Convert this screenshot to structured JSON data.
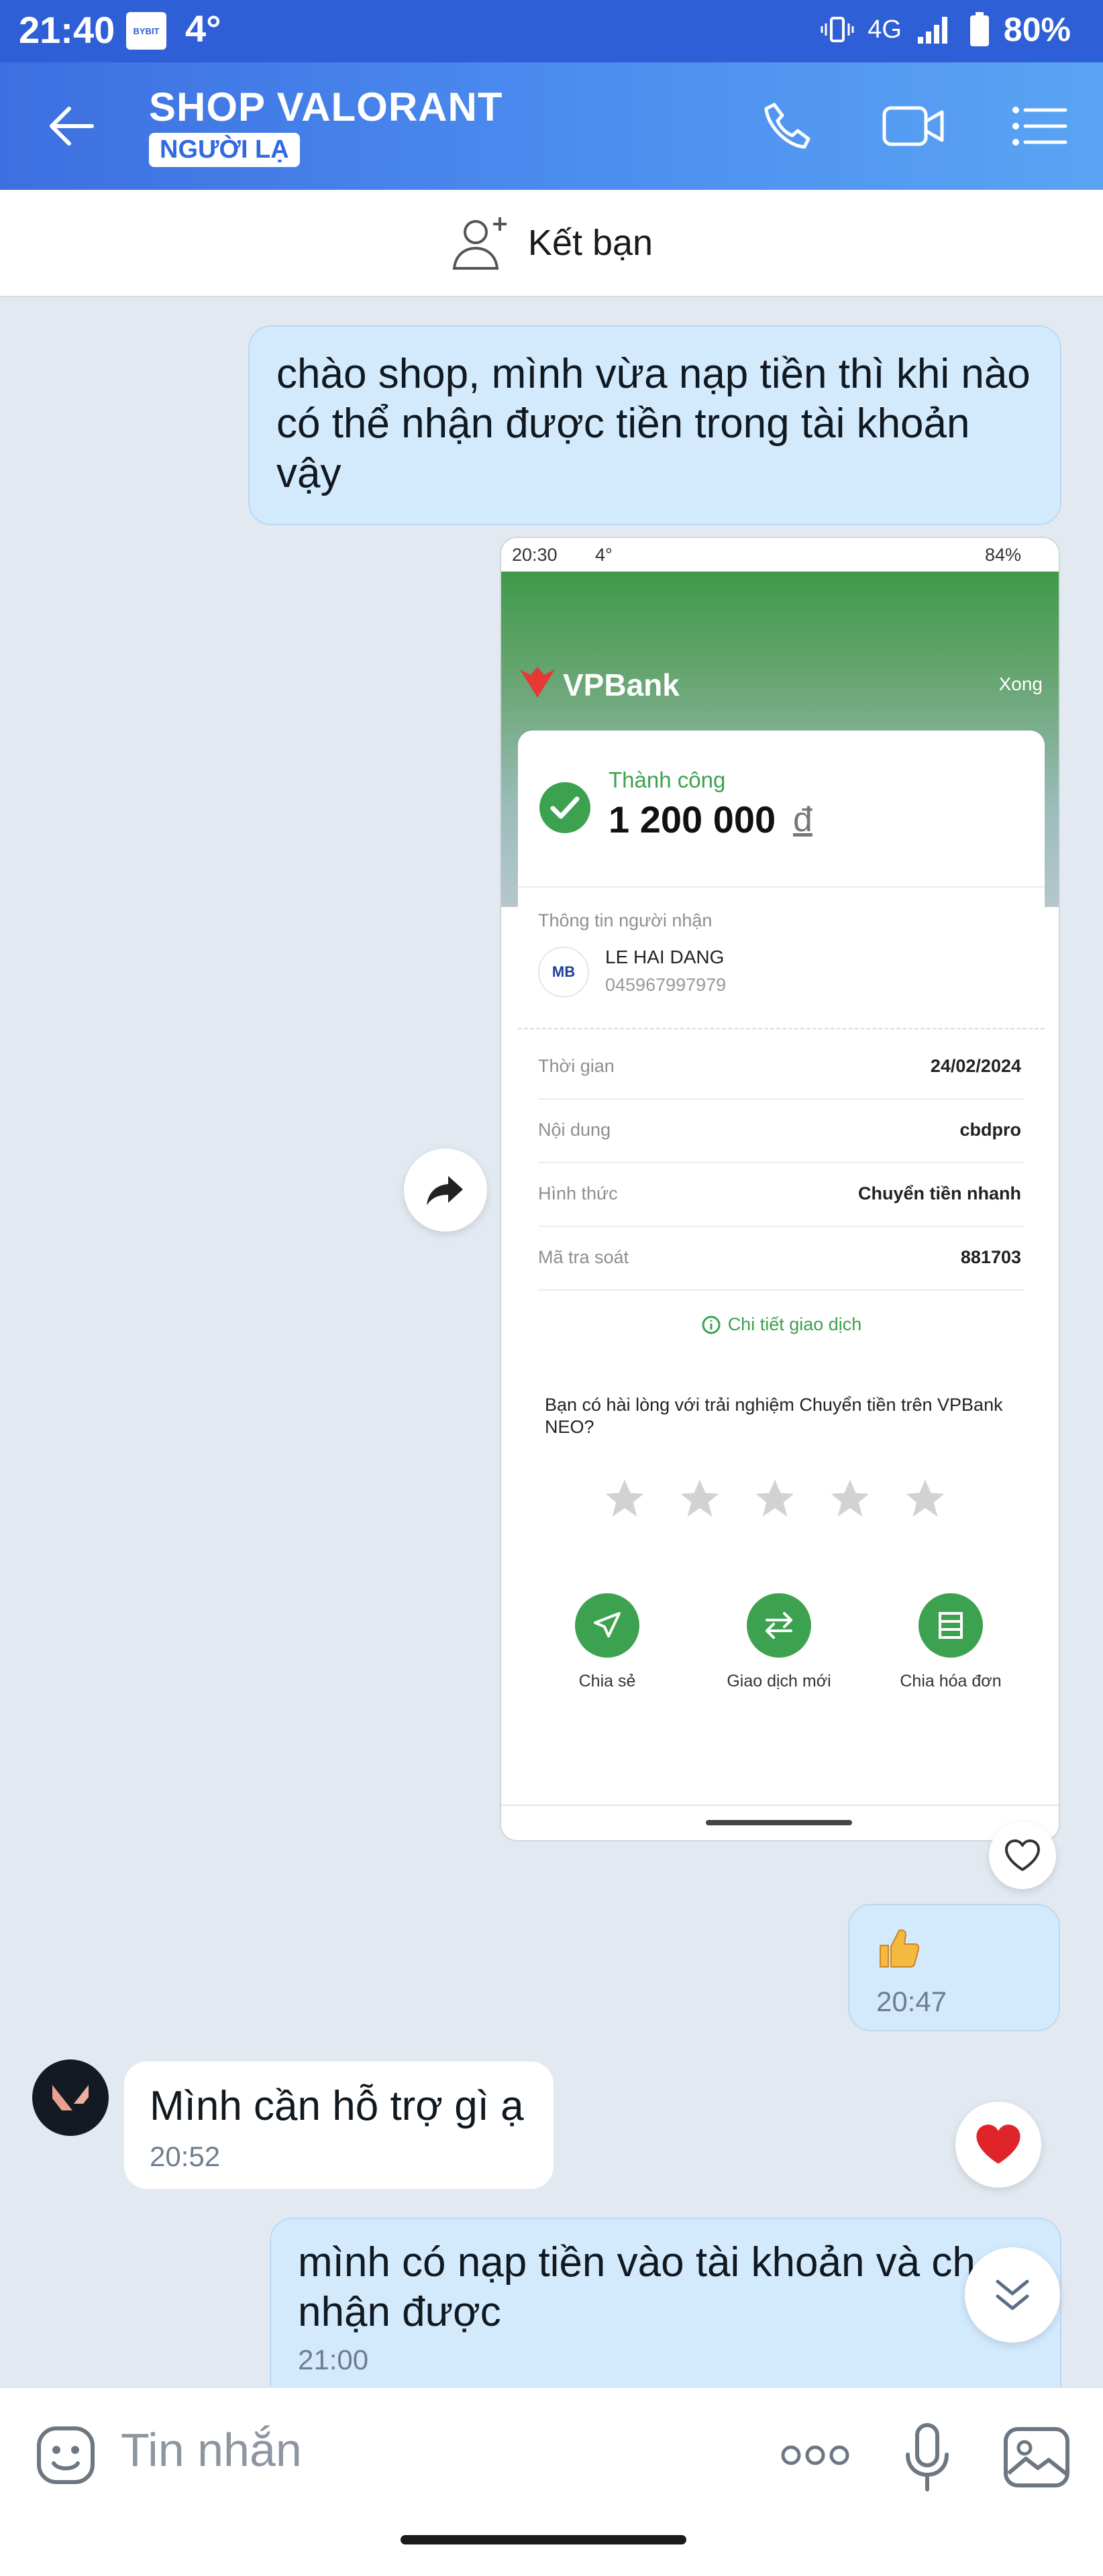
{
  "status_bar": {
    "time": "21:40",
    "app_badge": "BYBIT",
    "temperature": "4°",
    "network": "4G",
    "battery": "80%"
  },
  "header": {
    "title": "SHOP VALORANT",
    "badge": "NGƯỜI LẠ",
    "icons": [
      "back-arrow-icon",
      "phone-icon",
      "video-camera-icon",
      "menu-list-icon"
    ]
  },
  "add_friend": {
    "label": "Kết bạn"
  },
  "messages": {
    "m1": {
      "text": "chào shop, mình vừa nạp tiền thì khi nào có thể nhận được tiền trong tài khoản vậy"
    },
    "thumbs": {
      "time": "20:47"
    },
    "m2": {
      "text": "Mình cần hỗ trợ gì ạ",
      "time": "20:52"
    },
    "m3": {
      "text": "mình có nạp tiền vào tài khoản và ch",
      "text2": "nhận được",
      "time": "21:00"
    }
  },
  "receipt": {
    "status_time": "20:30",
    "status_temp": "4°",
    "status_battery": "84%",
    "bank": "VPBank",
    "done": "Xong",
    "success": "Thành công",
    "amount": "1 200 000",
    "currency": "đ",
    "recipient_heading": "Thông tin người nhận",
    "recipient_bank_logo": "MB",
    "recipient_name": "LE HAI DANG",
    "recipient_account": "045967997979",
    "rows": [
      {
        "label": "Thời gian",
        "value": "24/02/2024"
      },
      {
        "label": "Nội dung",
        "value": "cbdpro"
      },
      {
        "label": "Hình thức",
        "value": "Chuyển tiền nhanh"
      },
      {
        "label": "Mã tra soát",
        "value": "881703"
      }
    ],
    "detail_link": "Chi tiết giao dịch",
    "survey": "Bạn có hài lòng với trải nghiệm Chuyển tiền trên VPBank NEO?",
    "actions": [
      "Chia sẻ",
      "Giao dịch mới",
      "Chia hóa đơn"
    ]
  },
  "input": {
    "placeholder": "Tin nhắn"
  }
}
